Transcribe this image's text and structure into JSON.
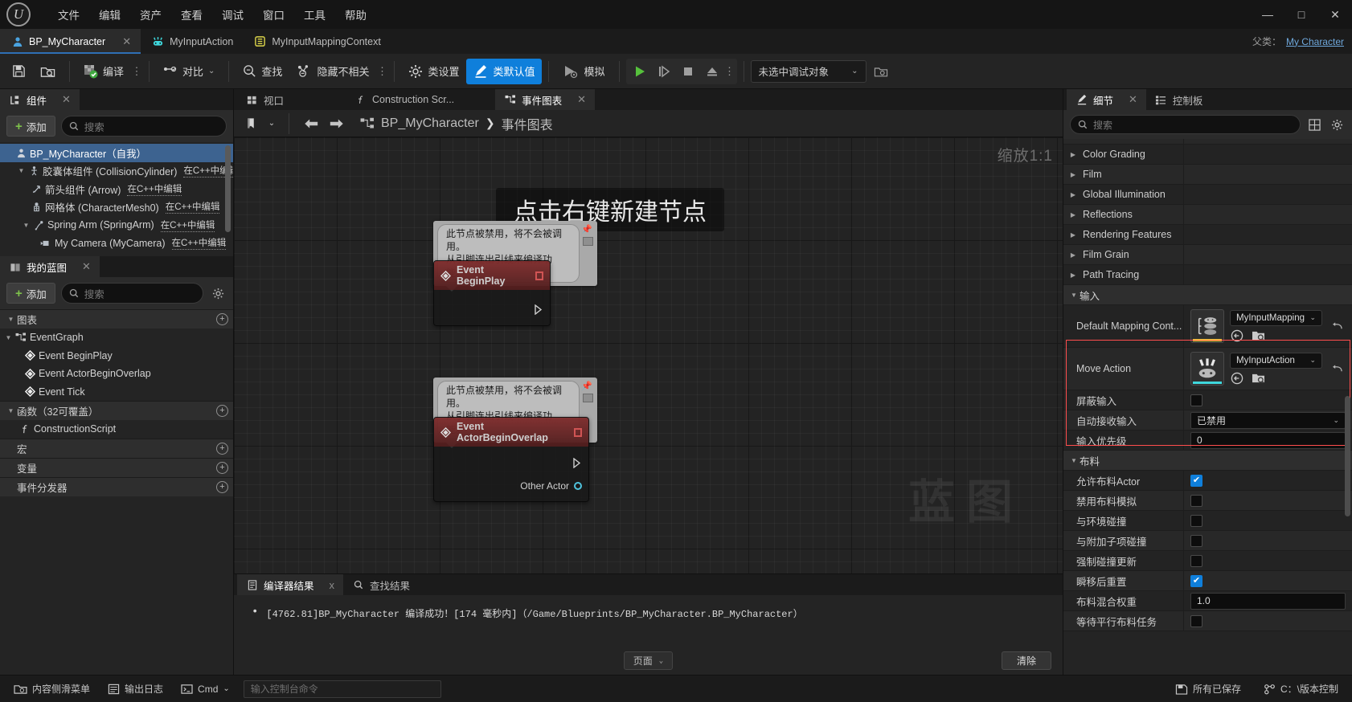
{
  "window": {
    "menu": [
      "文件",
      "编辑",
      "资产",
      "查看",
      "调试",
      "窗口",
      "工具",
      "帮助"
    ],
    "minimize": "—",
    "maximize": "□",
    "close": "✕"
  },
  "asset_tabs": [
    {
      "label": "BP_MyCharacter",
      "icon": "blueprint-character-icon",
      "active": true,
      "close": "✕"
    },
    {
      "label": "MyInputAction",
      "icon": "input-action-icon",
      "active": false
    },
    {
      "label": "MyInputMappingContext",
      "icon": "input-mapping-icon",
      "active": false
    }
  ],
  "parent_class": {
    "label": "父类：",
    "value": "My Character"
  },
  "toolbar": {
    "save": "保存",
    "browse": "浏览",
    "compile": "编译",
    "compile_kebab": "⋮",
    "diff": "对比",
    "find": "查找",
    "hide_unrelated": "隐藏不相关",
    "hide_kebab": "⋮",
    "class_settings": "类设置",
    "class_defaults": "类默认值",
    "simulate": "模拟",
    "play": "▶",
    "step": "⏭",
    "stop": "■",
    "eject": "⏏",
    "play_kebab": "⋮",
    "debug_target": "未选中调试对象",
    "debug_kebab": "⌕"
  },
  "components_panel": {
    "tab": "组件",
    "tab_close": "✕",
    "add": "添加",
    "search_placeholder": "搜索",
    "items": [
      {
        "label": "BP_MyCharacter（自我）",
        "icon": "character-icon",
        "indent": 0,
        "selected": true,
        "arrow": "",
        "cpp": ""
      },
      {
        "label": "胶囊体组件 (CollisionCylinder)",
        "icon": "capsule-icon",
        "indent": 1,
        "selected": false,
        "arrow": "▼",
        "cpp": "在C++中编辑"
      },
      {
        "label": "箭头组件 (Arrow)",
        "icon": "arrow-icon",
        "indent": 2,
        "selected": false,
        "arrow": "",
        "cpp": "在C++中编辑"
      },
      {
        "label": "网格体 (CharacterMesh0)",
        "icon": "mesh-icon",
        "indent": 2,
        "selected": false,
        "arrow": "",
        "cpp": "在C++中编辑"
      },
      {
        "label": "Spring Arm (SpringArm)",
        "icon": "springarm-icon",
        "indent": 2,
        "selected": false,
        "arrow": "▼",
        "cpp": "在C++中编辑"
      },
      {
        "label": "My Camera (MyCamera)",
        "icon": "camera-icon",
        "indent": 3,
        "selected": false,
        "arrow": "",
        "cpp": "在C++中编辑"
      }
    ]
  },
  "myblueprint_panel": {
    "tab": "我的蓝图",
    "tab_close": "✕",
    "add": "添加",
    "search_placeholder": "搜索",
    "sections": [
      {
        "title": "图表",
        "plus": "+",
        "items": [
          {
            "label": "EventGraph",
            "icon": "graph-icon",
            "indent": 0,
            "arrow": "▼"
          },
          {
            "label": "Event BeginPlay",
            "icon": "event-icon",
            "indent": 1,
            "arrow": ""
          },
          {
            "label": "Event ActorBeginOverlap",
            "icon": "event-icon",
            "indent": 1,
            "arrow": ""
          },
          {
            "label": "Event Tick",
            "icon": "event-icon",
            "indent": 1,
            "arrow": ""
          }
        ]
      },
      {
        "title": "函数（32可覆盖）",
        "plus": "+",
        "items": [
          {
            "label": "ConstructionScript",
            "icon": "function-icon",
            "indent": 0,
            "arrow": ""
          }
        ]
      },
      {
        "title": "宏",
        "plus": "+",
        "items": []
      },
      {
        "title": "变量",
        "plus": "+",
        "items": []
      },
      {
        "title": "事件分发器",
        "plus": "+",
        "items": []
      }
    ]
  },
  "graph": {
    "tabs": [
      {
        "label": "视口",
        "icon": "viewport-icon",
        "active": false
      },
      {
        "label": "Construction Scr...",
        "icon": "function-icon",
        "active": false
      },
      {
        "label": "事件图表",
        "icon": "graph-icon",
        "active": true,
        "close": "✕"
      }
    ],
    "toolbar": {
      "bookmark": "🔖",
      "chevron": "⌄",
      "back": "←",
      "forward": "→"
    },
    "breadcrumb": {
      "icon": "graph-icon",
      "root": "BP_MyCharacter",
      "sep": "❯",
      "current": "事件图表"
    },
    "zoom_label": "缩放1:1",
    "watermark": "蓝图",
    "hint": "点击右键新建节点",
    "nodes": [
      {
        "title": "Event BeginPlay",
        "comment": "此节点被禁用，将不会被调用。\n从引脚连出引线来编译功能。",
        "pins": []
      },
      {
        "title": "Event ActorBeginOverlap",
        "comment": "此节点被禁用，将不会被调用。\n从引脚连出引线来编译功能。",
        "pins": [
          "Other Actor"
        ]
      }
    ]
  },
  "results": {
    "tabs": [
      {
        "label": "编译器结果",
        "icon": "compiler-icon",
        "active": true,
        "close": "x"
      },
      {
        "label": "查找结果",
        "icon": "search-icon",
        "active": false
      }
    ],
    "log_line": "[4762.81]BP_MyCharacter 编译成功！[174 毫秒内]（/Game/Blueprints/BP_MyCharacter.BP_MyCharacter）",
    "page_label": "页面",
    "clear_label": "清除"
  },
  "details": {
    "tabs": [
      {
        "label": "细节",
        "icon": "details-icon",
        "active": true,
        "close": "✕"
      },
      {
        "label": "控制板",
        "icon": "palette-icon",
        "active": false
      }
    ],
    "search_placeholder": "搜索",
    "grid_icon": "grid-view-icon",
    "settings_icon": "gear-icon",
    "collapsed_categories": [
      "Color Grading",
      "Film",
      "Global Illumination",
      "Reflections",
      "Rendering Features",
      "Film Grain",
      "Path Tracing"
    ],
    "input_category": {
      "title": "输入",
      "highlight_color": "#ff4d4d",
      "asset_rows": [
        {
          "name": "Default Mapping Cont...",
          "value": "MyInputMapping",
          "thumb_icon": "input-mapping-context-icon",
          "thumb_strip_color": "#f2e43a",
          "browse_icon": "browse-icon",
          "use_icon": "use-selected-icon",
          "revert_icon": "revert-icon"
        },
        {
          "name": "Move Action",
          "value": "MyInputAction",
          "thumb_icon": "input-action-icon",
          "thumb_strip_color": "#3fd8dd",
          "browse_icon": "browse-icon",
          "use_icon": "use-selected-icon",
          "revert_icon": "revert-icon"
        }
      ],
      "rows": [
        {
          "name": "屏蔽输入",
          "type": "checkbox",
          "checked": false
        },
        {
          "name": "自动接收输入",
          "type": "dropdown",
          "value": "已禁用"
        },
        {
          "name": "输入优先级",
          "type": "text",
          "value": "0"
        }
      ]
    },
    "cloth_category": {
      "title": "布料",
      "rows": [
        {
          "name": "允许布料Actor",
          "type": "checkbox",
          "checked": true
        },
        {
          "name": "禁用布料模拟",
          "type": "checkbox",
          "checked": false
        },
        {
          "name": "与环境碰撞",
          "type": "checkbox",
          "checked": false
        },
        {
          "name": "与附加子项碰撞",
          "type": "checkbox",
          "checked": false
        },
        {
          "name": "强制碰撞更新",
          "type": "checkbox",
          "checked": false
        },
        {
          "name": "瞬移后重置",
          "type": "checkbox",
          "checked": true
        },
        {
          "name": "布料混合权重",
          "type": "text",
          "value": "1.0"
        },
        {
          "name": "等待平行布料任务",
          "type": "checkbox",
          "checked": false
        }
      ]
    }
  },
  "statusbar": {
    "content_drawer": "内容侧滑菜单",
    "output_log": "输出日志",
    "cmd_label": "Cmd",
    "cmd_chevron": "⌄",
    "cmd_placeholder": "输入控制台命令",
    "all_saved": "所有已保存",
    "revision": "C：\\版本控制"
  }
}
